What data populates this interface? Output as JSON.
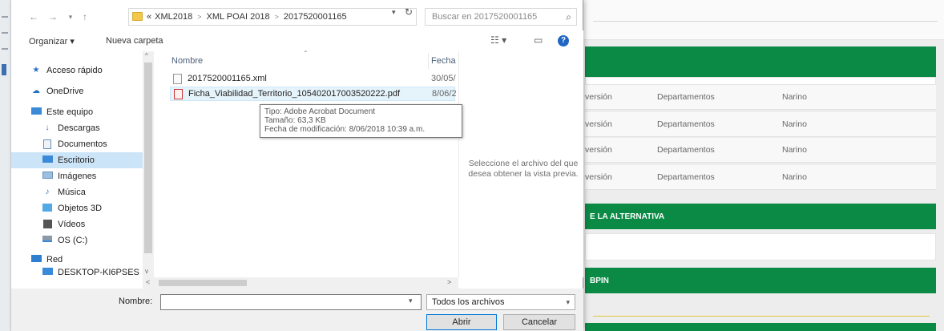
{
  "dialog": {
    "breadcrumb": [
      "«",
      "XML2018",
      "XML POAI 2018",
      "2017520001165"
    ],
    "search_placeholder": "Buscar en 2017520001165",
    "toolbar": {
      "organize": "Organizar ▾",
      "new_folder": "Nueva carpeta"
    },
    "nav_items": [
      {
        "label": "Acceso rápido",
        "icon": "star-icon"
      },
      {
        "label": "OneDrive",
        "icon": "cloud-icon"
      },
      {
        "label": "Este equipo",
        "icon": "computer-icon"
      },
      {
        "label": "Descargas",
        "icon": "download-icon"
      },
      {
        "label": "Documentos",
        "icon": "document-icon"
      },
      {
        "label": "Escritorio",
        "icon": "desktop-icon",
        "selected": true
      },
      {
        "label": "Imágenes",
        "icon": "image-icon"
      },
      {
        "label": "Música",
        "icon": "music-icon"
      },
      {
        "label": "Objetos 3D",
        "icon": "cube-icon"
      },
      {
        "label": "Vídeos",
        "icon": "video-icon"
      },
      {
        "label": "OS (C:)",
        "icon": "drive-icon"
      },
      {
        "label": "Red",
        "icon": "network-icon"
      },
      {
        "label": "DESKTOP-KI6PSES",
        "icon": "computer-icon"
      }
    ],
    "columns": {
      "name": "Nombre",
      "date": "Fecha"
    },
    "files": [
      {
        "name": "2017520001165.xml",
        "date": "30/05/",
        "type": "xml"
      },
      {
        "name": "Ficha_Viabilidad_Territorio_105402017003520222.pdf",
        "date": "8/06/2",
        "type": "pdf"
      }
    ],
    "tooltip": {
      "type": "Tipo: Adobe Acrobat Document",
      "size": "Tamaño: 63,3 KB",
      "modified": "Fecha de modificación: 8/06/2018 10:39 a.m."
    },
    "preview_message": "Seleccione el archivo del que desea obtener la vista previa.",
    "filename_label": "Nombre:",
    "filename_value": "",
    "filter": "Todos los archivos",
    "open_button": "Abrir",
    "cancel_button": "Cancelar"
  },
  "background": {
    "rows": [
      {
        "col1": "versión",
        "col2": "Departamentos",
        "col3": "Narino"
      },
      {
        "col1": "versión",
        "col2": "Departamentos",
        "col3": "Narino"
      },
      {
        "col1": "versión",
        "col2": "Departamentos",
        "col3": "Narino"
      },
      {
        "col1": "versión",
        "col2": "Departamentos",
        "col3": "Narino"
      }
    ],
    "section_alternativa": "E LA ALTERNATIVA",
    "section_bpin": "BPIN"
  },
  "colors": {
    "green": "#0a8a45",
    "selection": "#cce4f7",
    "accent": "#0078d7"
  }
}
